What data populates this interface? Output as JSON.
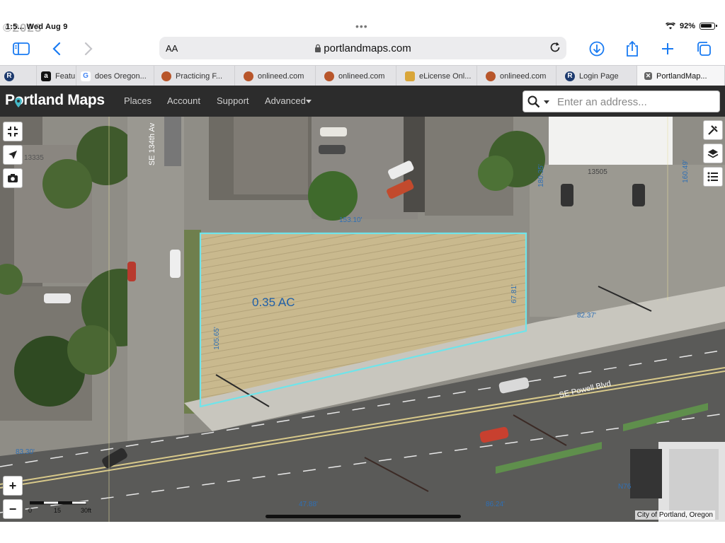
{
  "statusbar": {
    "time": "1:5... Wed Aug 9",
    "battery": "92%"
  },
  "watermark": "©2023",
  "browser": {
    "reader_label": "AA",
    "url": "portlandmaps.com",
    "tabs": [
      {
        "label": "R",
        "icon": "R"
      },
      {
        "label": "Featu...",
        "icon": "a"
      },
      {
        "label": "does Oregon...",
        "icon": "G"
      },
      {
        "label": "Practicing F...",
        "icon": "seal"
      },
      {
        "label": "onlineed.com",
        "icon": "seal"
      },
      {
        "label": "onlineed.com",
        "icon": "seal"
      },
      {
        "label": "eLicense Onl...",
        "icon": "elic"
      },
      {
        "label": "onlineed.com",
        "icon": "seal"
      },
      {
        "label": "Login Page",
        "icon": "R"
      },
      {
        "label": "PortlandMap...",
        "icon": "close"
      }
    ]
  },
  "header": {
    "logo": "Portland Maps",
    "nav": [
      "Places",
      "Account",
      "Support",
      "Advanced"
    ],
    "search_placeholder": "Enter an address..."
  },
  "map": {
    "area_label": "0.35 AC",
    "street_labels": {
      "powell": "SE Powell Blvd",
      "ave": "SE 134th Av"
    },
    "dimensions": {
      "top": "153.10'",
      "left": "105.65'",
      "right": "67.81'",
      "bottom_right": "82.37'",
      "east_a": "160.49'",
      "east_b": "180.35'",
      "sw": "83.30'",
      "s1": "47.88'",
      "s2": "86.24'",
      "parcel_w": "13335",
      "parcel_e": "13505",
      "n76": "N76"
    },
    "scale_labels": [
      "0",
      "15",
      "30ft"
    ],
    "credit": "City of Portland, Oregon",
    "zoom_in": "+",
    "zoom_out": "−"
  }
}
